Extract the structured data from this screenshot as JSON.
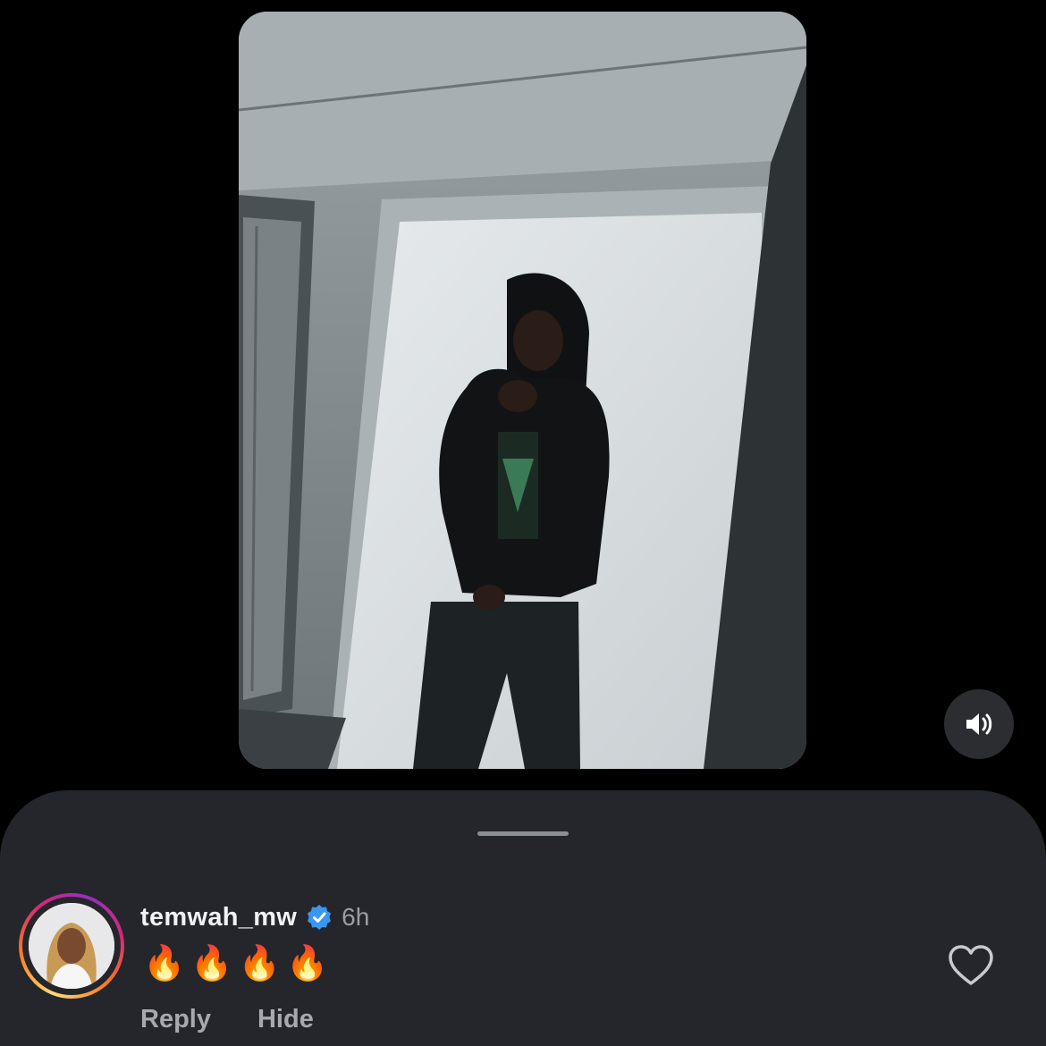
{
  "media": {
    "alt_icon": "video-frame",
    "sound_icon": "speaker-volume-icon"
  },
  "comment": {
    "username": "temwah_mw",
    "verified_icon": "verified-badge-icon",
    "time": "6h",
    "text": "🔥🔥🔥🔥",
    "reply_label": "Reply",
    "hide_label": "Hide",
    "like_icon": "heart-outline-icon"
  },
  "colors": {
    "background": "#000000",
    "sheet": "#24262b",
    "verified": "#3897f0",
    "ring_start": "#feda75",
    "ring_end": "#d62976"
  }
}
